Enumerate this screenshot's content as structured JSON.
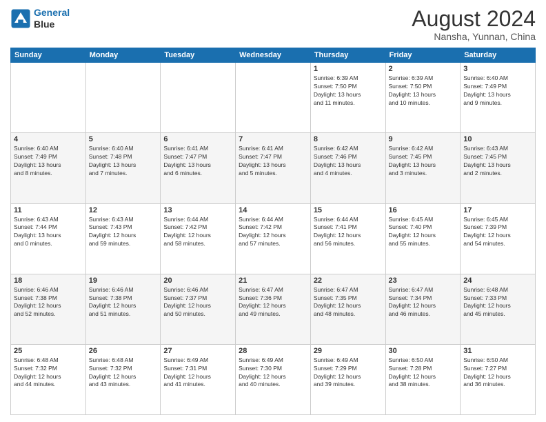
{
  "logo": {
    "line1": "General",
    "line2": "Blue"
  },
  "header": {
    "month": "August 2024",
    "location": "Nansha, Yunnan, China"
  },
  "days_of_week": [
    "Sunday",
    "Monday",
    "Tuesday",
    "Wednesday",
    "Thursday",
    "Friday",
    "Saturday"
  ],
  "weeks": [
    [
      {
        "num": "",
        "info": ""
      },
      {
        "num": "",
        "info": ""
      },
      {
        "num": "",
        "info": ""
      },
      {
        "num": "",
        "info": ""
      },
      {
        "num": "1",
        "info": "Sunrise: 6:39 AM\nSunset: 7:50 PM\nDaylight: 13 hours\nand 11 minutes."
      },
      {
        "num": "2",
        "info": "Sunrise: 6:39 AM\nSunset: 7:50 PM\nDaylight: 13 hours\nand 10 minutes."
      },
      {
        "num": "3",
        "info": "Sunrise: 6:40 AM\nSunset: 7:49 PM\nDaylight: 13 hours\nand 9 minutes."
      }
    ],
    [
      {
        "num": "4",
        "info": "Sunrise: 6:40 AM\nSunset: 7:49 PM\nDaylight: 13 hours\nand 8 minutes."
      },
      {
        "num": "5",
        "info": "Sunrise: 6:40 AM\nSunset: 7:48 PM\nDaylight: 13 hours\nand 7 minutes."
      },
      {
        "num": "6",
        "info": "Sunrise: 6:41 AM\nSunset: 7:47 PM\nDaylight: 13 hours\nand 6 minutes."
      },
      {
        "num": "7",
        "info": "Sunrise: 6:41 AM\nSunset: 7:47 PM\nDaylight: 13 hours\nand 5 minutes."
      },
      {
        "num": "8",
        "info": "Sunrise: 6:42 AM\nSunset: 7:46 PM\nDaylight: 13 hours\nand 4 minutes."
      },
      {
        "num": "9",
        "info": "Sunrise: 6:42 AM\nSunset: 7:45 PM\nDaylight: 13 hours\nand 3 minutes."
      },
      {
        "num": "10",
        "info": "Sunrise: 6:43 AM\nSunset: 7:45 PM\nDaylight: 13 hours\nand 2 minutes."
      }
    ],
    [
      {
        "num": "11",
        "info": "Sunrise: 6:43 AM\nSunset: 7:44 PM\nDaylight: 13 hours\nand 0 minutes."
      },
      {
        "num": "12",
        "info": "Sunrise: 6:43 AM\nSunset: 7:43 PM\nDaylight: 12 hours\nand 59 minutes."
      },
      {
        "num": "13",
        "info": "Sunrise: 6:44 AM\nSunset: 7:42 PM\nDaylight: 12 hours\nand 58 minutes."
      },
      {
        "num": "14",
        "info": "Sunrise: 6:44 AM\nSunset: 7:42 PM\nDaylight: 12 hours\nand 57 minutes."
      },
      {
        "num": "15",
        "info": "Sunrise: 6:44 AM\nSunset: 7:41 PM\nDaylight: 12 hours\nand 56 minutes."
      },
      {
        "num": "16",
        "info": "Sunrise: 6:45 AM\nSunset: 7:40 PM\nDaylight: 12 hours\nand 55 minutes."
      },
      {
        "num": "17",
        "info": "Sunrise: 6:45 AM\nSunset: 7:39 PM\nDaylight: 12 hours\nand 54 minutes."
      }
    ],
    [
      {
        "num": "18",
        "info": "Sunrise: 6:46 AM\nSunset: 7:38 PM\nDaylight: 12 hours\nand 52 minutes."
      },
      {
        "num": "19",
        "info": "Sunrise: 6:46 AM\nSunset: 7:38 PM\nDaylight: 12 hours\nand 51 minutes."
      },
      {
        "num": "20",
        "info": "Sunrise: 6:46 AM\nSunset: 7:37 PM\nDaylight: 12 hours\nand 50 minutes."
      },
      {
        "num": "21",
        "info": "Sunrise: 6:47 AM\nSunset: 7:36 PM\nDaylight: 12 hours\nand 49 minutes."
      },
      {
        "num": "22",
        "info": "Sunrise: 6:47 AM\nSunset: 7:35 PM\nDaylight: 12 hours\nand 48 minutes."
      },
      {
        "num": "23",
        "info": "Sunrise: 6:47 AM\nSunset: 7:34 PM\nDaylight: 12 hours\nand 46 minutes."
      },
      {
        "num": "24",
        "info": "Sunrise: 6:48 AM\nSunset: 7:33 PM\nDaylight: 12 hours\nand 45 minutes."
      }
    ],
    [
      {
        "num": "25",
        "info": "Sunrise: 6:48 AM\nSunset: 7:32 PM\nDaylight: 12 hours\nand 44 minutes."
      },
      {
        "num": "26",
        "info": "Sunrise: 6:48 AM\nSunset: 7:32 PM\nDaylight: 12 hours\nand 43 minutes."
      },
      {
        "num": "27",
        "info": "Sunrise: 6:49 AM\nSunset: 7:31 PM\nDaylight: 12 hours\nand 41 minutes."
      },
      {
        "num": "28",
        "info": "Sunrise: 6:49 AM\nSunset: 7:30 PM\nDaylight: 12 hours\nand 40 minutes."
      },
      {
        "num": "29",
        "info": "Sunrise: 6:49 AM\nSunset: 7:29 PM\nDaylight: 12 hours\nand 39 minutes."
      },
      {
        "num": "30",
        "info": "Sunrise: 6:50 AM\nSunset: 7:28 PM\nDaylight: 12 hours\nand 38 minutes."
      },
      {
        "num": "31",
        "info": "Sunrise: 6:50 AM\nSunset: 7:27 PM\nDaylight: 12 hours\nand 36 minutes."
      }
    ]
  ]
}
